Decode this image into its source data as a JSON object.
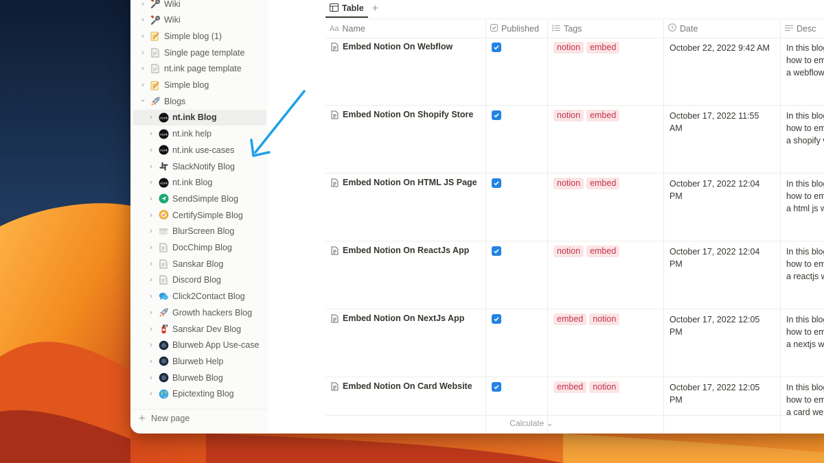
{
  "colors": {
    "accent": "#2383e2",
    "tag_bg": "#fbe4e4",
    "tag_text": "#c4354f",
    "arrow": "#1ea1e6"
  },
  "sidebar": {
    "items": [
      {
        "label": "Wiki",
        "icon": "tools-icon",
        "level": 0
      },
      {
        "label": "Wiki",
        "icon": "tools-icon",
        "level": 0
      },
      {
        "label": "Simple blog (1)",
        "icon": "memo-icon",
        "level": 0
      },
      {
        "label": "Single page template",
        "icon": "page-icon",
        "level": 0
      },
      {
        "label": "nt.ink page template",
        "icon": "page-icon",
        "level": 0
      },
      {
        "label": "Simple blog",
        "icon": "memo-icon",
        "level": 0
      },
      {
        "label": "Blogs",
        "icon": "rocket-icon",
        "level": 0,
        "expanded": true
      },
      {
        "label": "nt.ink Blog",
        "icon": "ntink-logo-icon",
        "level": 1,
        "active": true
      },
      {
        "label": "nt.ink help",
        "icon": "ntink-logo-icon",
        "level": 1
      },
      {
        "label": "nt.ink use-cases",
        "icon": "ntink-logo-icon",
        "level": 1
      },
      {
        "label": "SlackNotify Blog",
        "icon": "slack-icon",
        "level": 1
      },
      {
        "label": "nt.ink Blog",
        "icon": "ntink-logo-icon",
        "level": 1
      },
      {
        "label": "SendSimple Blog",
        "icon": "send-icon",
        "level": 1
      },
      {
        "label": "CertifySimple Blog",
        "icon": "certificate-icon",
        "level": 1
      },
      {
        "label": "BlurScreen Blog",
        "icon": "blurscreen-icon",
        "level": 1
      },
      {
        "label": "DocChimp Blog",
        "icon": "page-icon",
        "level": 1
      },
      {
        "label": "Sanskar Blog",
        "icon": "page-icon",
        "level": 1
      },
      {
        "label": "Discord Blog",
        "icon": "page-icon",
        "level": 1
      },
      {
        "label": "Click2Contact Blog",
        "icon": "chat-icon",
        "level": 1
      },
      {
        "label": "Growth hackers Blog",
        "icon": "rocket-icon",
        "level": 1
      },
      {
        "label": "Sanskar Dev Blog",
        "icon": "fire-extinguisher-icon",
        "level": 1
      },
      {
        "label": "Blurweb App Use-case",
        "icon": "blurweb-icon",
        "level": 1
      },
      {
        "label": "Blurweb Help",
        "icon": "blurweb-icon",
        "level": 1
      },
      {
        "label": "Blurweb Blog",
        "icon": "blurweb-icon",
        "level": 1
      },
      {
        "label": "Epictexting Blog",
        "icon": "globe-icon",
        "level": 1
      }
    ],
    "new_page_label": "New page"
  },
  "main": {
    "tab_label": "Table",
    "columns": {
      "name": "Name",
      "name_prefix": "Aa",
      "published": "Published",
      "tags": "Tags",
      "date": "Date",
      "desc": "Desc"
    },
    "rows": [
      {
        "name": "Embed Notion On Webflow",
        "published": true,
        "tags": [
          "notion",
          "embed"
        ],
        "date": [
          "October 22, 2022 9:42 AM"
        ],
        "desc": [
          "In this blog",
          "how to em",
          "a webflow"
        ]
      },
      {
        "name": "Embed Notion On Shopify Store",
        "published": true,
        "tags": [
          "notion",
          "embed"
        ],
        "date": [
          "October 17, 2022 11:55",
          "AM"
        ],
        "desc": [
          "In this blog",
          "how to em",
          "a shopify w"
        ]
      },
      {
        "name": "Embed Notion On HTML JS Page",
        "published": true,
        "tags": [
          "notion",
          "embed"
        ],
        "date": [
          "October 17, 2022 12:04",
          "PM"
        ],
        "desc": [
          "In this blog",
          "how to em",
          "a html js w"
        ]
      },
      {
        "name": "Embed Notion On ReactJs App",
        "published": true,
        "tags": [
          "notion",
          "embed"
        ],
        "date": [
          "October 17, 2022 12:04",
          "PM"
        ],
        "desc": [
          "In this blog",
          "how to em",
          "a reactjs w"
        ]
      },
      {
        "name": "Embed Notion On NextJs App",
        "published": true,
        "tags": [
          "embed",
          "notion"
        ],
        "date": [
          "October 17, 2022 12:05",
          "PM"
        ],
        "desc": [
          "In this blog",
          "how to em",
          "a nextjs w"
        ]
      },
      {
        "name": "Embed Notion On Card Website",
        "published": true,
        "tags": [
          "embed",
          "notion"
        ],
        "date": [
          "October 17, 2022 12:05",
          "PM"
        ],
        "desc": [
          "In this blog",
          "how to em",
          "a card web"
        ]
      }
    ],
    "calculate_label": "Calculate"
  }
}
